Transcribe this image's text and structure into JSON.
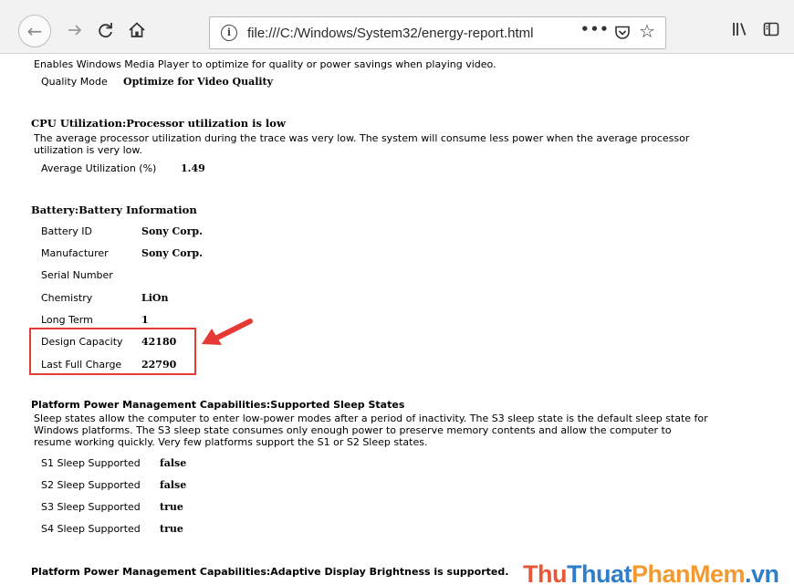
{
  "browser": {
    "url": "file:///C:/Windows/System32/energy-report.html",
    "url_info_glyph": "i",
    "page_actions_glyph": "•••",
    "icons": [
      "back-arrow-icon",
      "forward-arrow-icon",
      "reload-icon",
      "home-icon",
      "info-icon",
      "page-actions-icon",
      "pocket-icon",
      "bookmark-star-icon",
      "library-icon",
      "sidebar-icon"
    ]
  },
  "report": {
    "video_playback": {
      "description": "Enables Windows Media Player to optimize for quality or power savings when playing video.",
      "label": "Quality Mode",
      "value": "Optimize for Video Quality"
    },
    "cpu": {
      "heading": "CPU Utilization:Processor utilization is low",
      "description_line1": "The average processor utilization during the trace was very low. The system will consume less power when the average processor",
      "description_line2": "utilization is very low.",
      "label": "Average Utilization (%)",
      "value": "1.49"
    },
    "battery": {
      "heading": "Battery:Battery Information",
      "rows": [
        {
          "label": "Battery ID",
          "value": "Sony Corp."
        },
        {
          "label": "Manufacturer",
          "value": "Sony Corp."
        },
        {
          "label": "Serial Number",
          "value": ""
        },
        {
          "label": "Chemistry",
          "value": "LiOn"
        },
        {
          "label": "Long Term",
          "value": "1"
        },
        {
          "label": "Design Capacity",
          "value": "42180"
        },
        {
          "label": "Last Full Charge",
          "value": "22790"
        }
      ]
    },
    "sleep_states": {
      "heading": "Platform Power Management Capabilities:Supported Sleep States",
      "description_line1": "Sleep states allow the computer to enter low-power modes after a period of inactivity. The S3 sleep state is the default sleep state for",
      "description_line2": "Windows platforms. The S3 sleep state consumes only enough power to preserve memory contents and allow the computer to",
      "description_line3": "resume working quickly. Very few platforms support the S1 or S2 Sleep states.",
      "rows": [
        {
          "label": "S1 Sleep Supported",
          "value": "false"
        },
        {
          "label": "S2 Sleep Supported",
          "value": "false"
        },
        {
          "label": "S3 Sleep Supported",
          "value": "true"
        },
        {
          "label": "S4 Sleep Supported",
          "value": "true"
        }
      ]
    },
    "brightness": {
      "heading": "Platform Power Management Capabilities:Adaptive Display Brightness is supported."
    }
  },
  "annotation": {
    "highlight_color": "#e53935"
  },
  "watermark": {
    "part1": "Thu",
    "part2": "Thuat",
    "part3": "PhanMem",
    "part4": ".vn"
  }
}
